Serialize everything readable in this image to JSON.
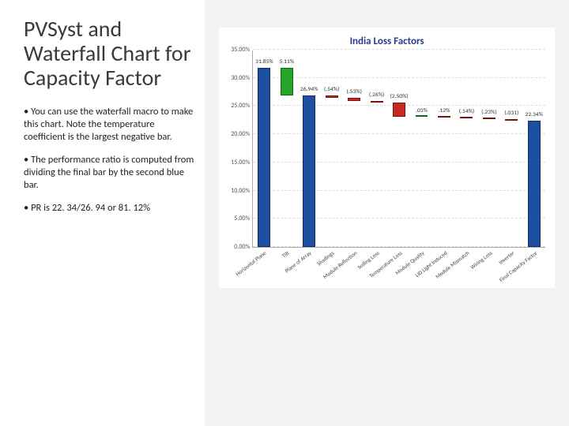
{
  "title": "PVSyst and Waterfall Chart for Capacity Factor",
  "bullets": [
    "You can use the waterfall macro to make this chart. Note the temperature coefficient is the largest negative bar.",
    "The performance ratio is computed from dividing the final bar by the second blue bar.",
    "PR is 22. 34/26. 94 or 81. 12%"
  ],
  "chart_data": {
    "type": "waterfall",
    "title": "India Loss Factors",
    "ylabel": "",
    "xlabel": "",
    "ylim": [
      0,
      35
    ],
    "yticks": [
      "0.00%",
      "5.00%",
      "10.00%",
      "15.00%",
      "20.00%",
      "25.00%",
      "30.00%",
      "35.00%"
    ],
    "categories": [
      "Horizontal Plane",
      "Tilt",
      "Plane of Array",
      "Shadings",
      "Module Reflection",
      "Soiling Loss",
      "Temperature Loss",
      "Module Quality",
      "LID Light Induced",
      "Module Mismatch",
      "Wiring Loss",
      "Inverter",
      "Final Capacity Factor"
    ],
    "bars": [
      {
        "label": "31.85%",
        "kind": "total",
        "start": 0.0,
        "end": 31.85,
        "color": "blue"
      },
      {
        "label": "5.11%",
        "kind": "increase",
        "start": 31.85,
        "end": 26.94,
        "color": "green"
      },
      {
        "label": "26.94%",
        "kind": "total",
        "start": 0.0,
        "end": 26.94,
        "color": "blue"
      },
      {
        "label": "(.54%)",
        "kind": "decrease",
        "start": 26.94,
        "end": 26.4,
        "color": "red"
      },
      {
        "label": "(.53%)",
        "kind": "decrease",
        "start": 26.4,
        "end": 25.87,
        "color": "red"
      },
      {
        "label": "(.26%)",
        "kind": "decrease",
        "start": 25.87,
        "end": 25.61,
        "color": "red"
      },
      {
        "label": "(2.50%)",
        "kind": "decrease",
        "start": 25.61,
        "end": 23.11,
        "color": "red"
      },
      {
        "label": ".03%",
        "kind": "increase",
        "start": 23.11,
        "end": 23.14,
        "color": "green"
      },
      {
        "label": ".12%",
        "kind": "decrease",
        "start": 23.14,
        "end": 23.02,
        "color": "red"
      },
      {
        "label": "(.14%)",
        "kind": "decrease",
        "start": 23.02,
        "end": 22.88,
        "color": "red"
      },
      {
        "label": "(.23%)",
        "kind": "decrease",
        "start": 22.88,
        "end": 22.65,
        "color": "red"
      },
      {
        "label": "(.031)",
        "kind": "decrease",
        "start": 22.65,
        "end": 22.34,
        "color": "red"
      },
      {
        "label": "22.34%",
        "kind": "total",
        "start": 0.0,
        "end": 22.34,
        "color": "blue"
      }
    ]
  }
}
